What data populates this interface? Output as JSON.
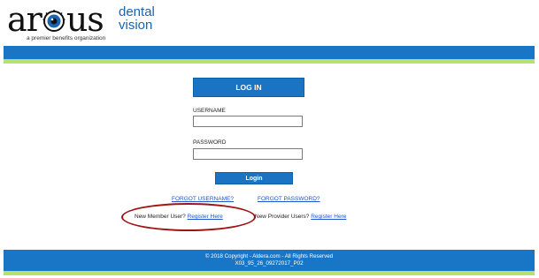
{
  "brand": {
    "word_part1": "ar",
    "word_part2": "us",
    "dental": "dental",
    "vision": "vision",
    "tagline": "a premier benefits organization",
    "colors": {
      "primary_blue": "#1975c5",
      "accent_green": "#b7df73",
      "logo_blue": "#1a64b0"
    }
  },
  "login": {
    "header": "LOG IN",
    "username_label": "USERNAME",
    "username_value": "",
    "password_label": "PASSWORD",
    "password_value": "",
    "login_button": "Login"
  },
  "links": {
    "forgot_username": "FORGOT USERNAME?",
    "forgot_password": "FORGOT PASSWORD?",
    "new_member_prompt": "New Member User?",
    "new_member_link": "Register Here",
    "new_provider_prompt": "New Provider Users?",
    "new_provider_link": "Register Here"
  },
  "footer": {
    "copyright": "© 2018 Copyright - Aldera.com - All Rights Reserved",
    "build": "X03_95_26_09272017_P02"
  }
}
